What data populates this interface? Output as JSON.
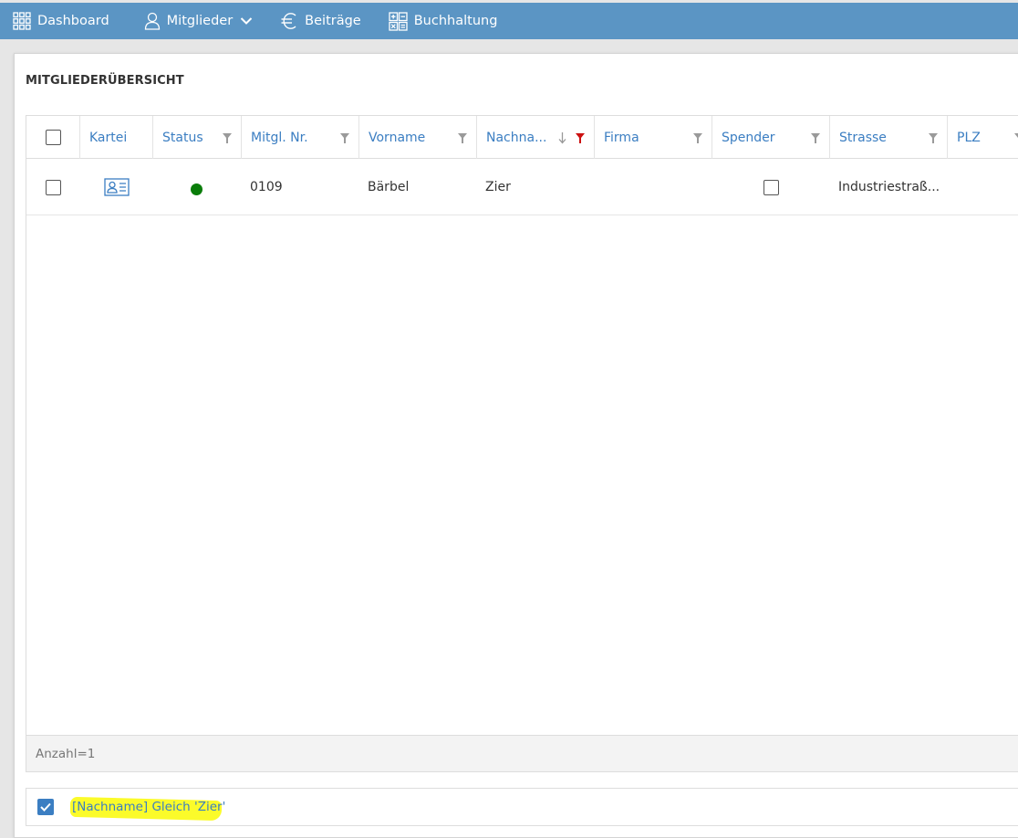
{
  "nav": {
    "items": [
      {
        "label": "Dashboard",
        "icon": "grid-icon"
      },
      {
        "label": "Mitglieder",
        "icon": "user-icon"
      },
      {
        "label": "Beiträge",
        "icon": "euro-icon"
      },
      {
        "label": "Buchhaltung",
        "icon": "accounting-icon"
      }
    ]
  },
  "panel": {
    "title": "MITGLIEDERÜBERSICHT"
  },
  "grid": {
    "columns": [
      "Kartei",
      "Status",
      "Mitgl. Nr.",
      "Vorname",
      "Nachna...",
      "Firma",
      "Spender",
      "Strasse",
      "PLZ"
    ],
    "rows": [
      {
        "mitgl_nr": "0109",
        "vorname": "Bärbel",
        "nachname": "Zier",
        "firma": "",
        "strasse": "Industriestraß...",
        "plz": "",
        "status_color": "#0a7d0a"
      }
    ],
    "footer": "Anzahl=1"
  },
  "filter": {
    "text": "[Nachname] Gleich 'Zier'",
    "active": true
  },
  "colors": {
    "nav": "#5b95c4",
    "link": "#3b7ec2",
    "active_filter": "#cc1111",
    "highlight": "#fbfb2a"
  }
}
